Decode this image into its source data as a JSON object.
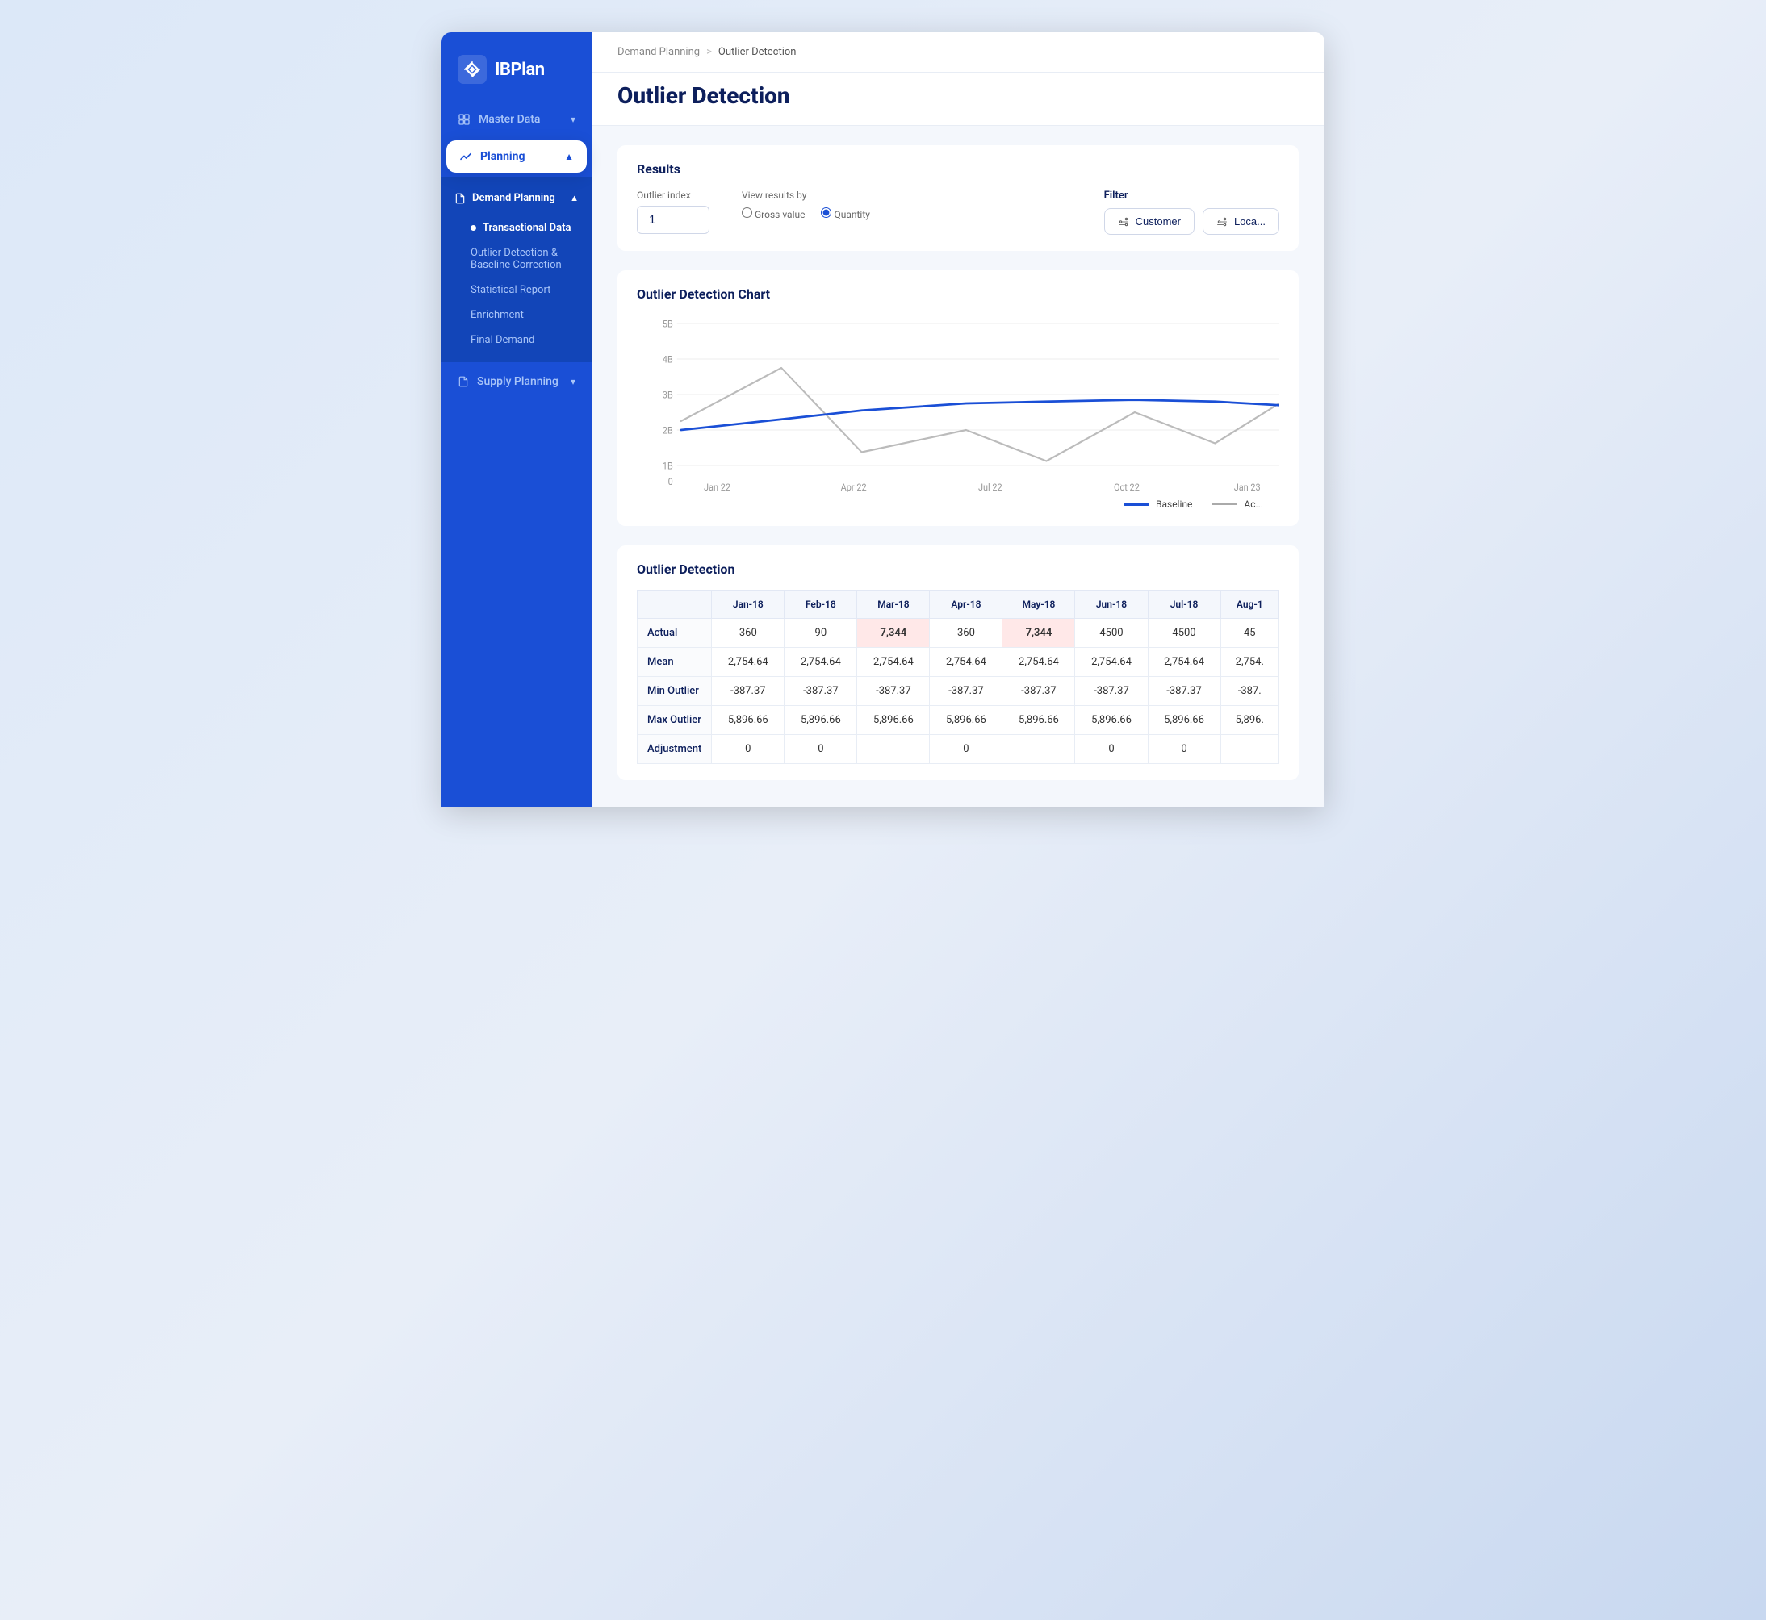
{
  "app": {
    "name": "IBPlan",
    "logo_alt": "IBPlan Logo"
  },
  "sidebar": {
    "master_data_label": "Master Data",
    "planning_label": "Planning",
    "demand_planning_label": "Demand Planning",
    "submenu": [
      {
        "label": "Transactional Data",
        "active": true
      },
      {
        "label": "Outlier Detection & Baseline Correction",
        "active": false
      },
      {
        "label": "Statistical Report",
        "active": false
      },
      {
        "label": "Enrichment",
        "active": false
      },
      {
        "label": "Final Demand",
        "active": false
      }
    ],
    "supply_planning_label": "Supply Planning"
  },
  "breadcrumb": {
    "parent": "Demand Planning",
    "separator": ">",
    "current": "Outlier Detection"
  },
  "page": {
    "title": "Outlier Detection"
  },
  "results": {
    "section_title": "Results",
    "outlier_index_label": "Outlier index",
    "outlier_index_value": "1",
    "view_results_label": "View results by",
    "radio_gross": "Gross value",
    "radio_quantity": "Quantity",
    "filter_label": "Filter",
    "filter_customer": "Customer",
    "filter_location": "Loca..."
  },
  "chart": {
    "title": "Outlier Detection Chart",
    "y_labels": [
      "5B",
      "4B",
      "3B",
      "2B",
      "1B",
      "0"
    ],
    "x_labels": [
      "Jan 22",
      "Apr 22",
      "Jul 22",
      "Oct 22",
      "Jan 23"
    ],
    "legend_baseline": "Baseline",
    "legend_actual": "Ac..."
  },
  "table": {
    "title": "Outlier Detection",
    "columns": [
      "",
      "Jan-18",
      "Feb-18",
      "Mar-18",
      "Apr-18",
      "May-18",
      "Jun-18",
      "Jul-18",
      "Aug-1"
    ],
    "rows": [
      {
        "label": "Actual",
        "values": [
          "360",
          "90",
          "7,344",
          "360",
          "7,344",
          "4500",
          "4500",
          "45"
        ],
        "highlights": [
          2,
          4
        ]
      },
      {
        "label": "Mean",
        "values": [
          "2,754.64",
          "2,754.64",
          "2,754.64",
          "2,754.64",
          "2,754.64",
          "2,754.64",
          "2,754.64",
          "2,754."
        ],
        "highlights": []
      },
      {
        "label": "Min Outlier",
        "values": [
          "-387.37",
          "-387.37",
          "-387.37",
          "-387.37",
          "-387.37",
          "-387.37",
          "-387.37",
          "-387."
        ],
        "highlights": []
      },
      {
        "label": "Max Outlier",
        "values": [
          "5,896.66",
          "5,896.66",
          "5,896.66",
          "5,896.66",
          "5,896.66",
          "5,896.66",
          "5,896.66",
          "5,896."
        ],
        "highlights": []
      },
      {
        "label": "Adjustment",
        "values": [
          "0",
          "0",
          "",
          "0",
          "",
          "0",
          "0",
          ""
        ],
        "highlights": []
      }
    ]
  }
}
